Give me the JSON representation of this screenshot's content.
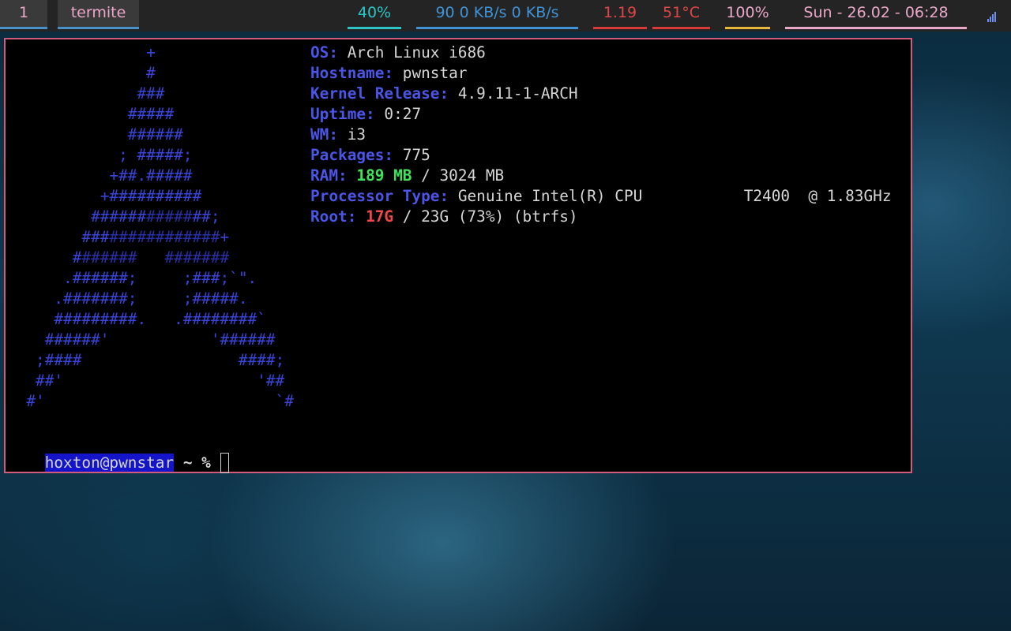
{
  "bar": {
    "workspace": "1",
    "window_title": "termite",
    "cpu": "40%",
    "net": "90  0 KB/s 0 KB/s",
    "load": "1.19",
    "temperature": "51°C",
    "battery": "100%",
    "clock": "Sun - 26.02 - 06:28",
    "tray_icon": "wifi-signal-icon",
    "colors": {
      "background": "#242424",
      "cpu": "#2ec4c4",
      "net": "#3f93d6",
      "load": "#e04646",
      "accent": "#eaa8c8",
      "battery_underline": "#e8b83a",
      "workspace_underline": "#4a90c8"
    }
  },
  "terminal": {
    "border_color": "#d35a78",
    "logo_lines": [
      [
        "               +",
        ""
      ],
      [
        "               #",
        ""
      ],
      [
        "              ###",
        ""
      ],
      [
        "             #####",
        ""
      ],
      [
        "             ######",
        ""
      ],
      [
        "            ; #####;",
        ""
      ],
      [
        "           +##.#####",
        ""
      ],
      [
        "          +##########",
        ""
      ],
      [
        "         ######",
        "#####",
        "##;"
      ],
      [
        "        ###",
        "############",
        "+"
      ],
      [
        "       #",
        "######   #######"
      ],
      [
        "      .######;     ;###;`\".",
        ""
      ],
      [
        "     .#######;     ;#####.",
        ""
      ],
      [
        "     #########.   .########`",
        ""
      ],
      [
        "    ######'           '######",
        ""
      ],
      [
        "   ;####                 ####;",
        ""
      ],
      [
        "   ##'                     '##",
        ""
      ],
      [
        "  #'                         `#",
        ""
      ]
    ],
    "info": [
      {
        "label": "OS:",
        "value": "Arch Linux i686"
      },
      {
        "label": "Hostname:",
        "value": "pwnstar"
      },
      {
        "label": "Kernel Release:",
        "value": "4.9.11-1-ARCH"
      },
      {
        "label": "Uptime:",
        "value": "0:27"
      },
      {
        "label": "WM:",
        "value": "i3"
      },
      {
        "label": "Packages:",
        "value": "775"
      },
      {
        "label": "RAM:",
        "highlight": "189 MB",
        "value": "/ 3024 MB"
      },
      {
        "label": "Processor Type:",
        "value": "Genuine Intel(R) CPU           T2400  @ 1.83GHz"
      },
      {
        "label": "Root:",
        "highlight": "17G",
        "value": "/ 23G (73%) (btrfs)"
      }
    ],
    "prompt": {
      "user_host": "hoxton@pwnstar",
      "dir_symbol": " ~ % "
    }
  }
}
